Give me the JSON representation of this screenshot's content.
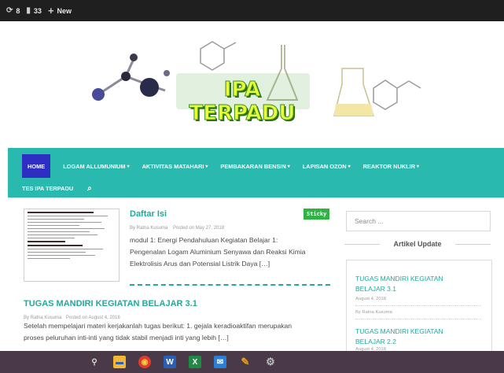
{
  "adminbar": {
    "items": [
      {
        "icon": "refresh-icon",
        "glyph": "⟳",
        "label": "8"
      },
      {
        "icon": "comment-icon",
        "glyph": "▮",
        "label": "33"
      },
      {
        "icon": "plus-icon",
        "glyph": "+",
        "label": "New"
      }
    ]
  },
  "site": {
    "title": "IPA TERPADU"
  },
  "nav": {
    "row1": [
      {
        "label": "HOME",
        "caret": ""
      },
      {
        "label": "LOGAM ALLUMUNIUM",
        "caret": "▾"
      },
      {
        "label": "AKTIVITAS MATAHARI",
        "caret": "▾"
      },
      {
        "label": "PEMBAKARAN BENSIN",
        "caret": "▾"
      },
      {
        "label": "LAPISAN OZON",
        "caret": "▾"
      },
      {
        "label": "REAKTOR NUKLIR",
        "caret": "▾"
      }
    ],
    "row2": [
      {
        "label": "TES IPA TERPADU"
      }
    ],
    "search_glyph": "⌕"
  },
  "posts": [
    {
      "title": "Daftar Isi",
      "badge": "Sticky",
      "author": "By Ratna Kusuma",
      "date": "Posted on May 27, 2018",
      "excerpt_lines": [
        "modul 1: Energi Pendahuluan Kegiatan Belajar 1:",
        "Pengenalan Logam Aluminium Senyawa dan Reaksi Kimia",
        "Elektrolisis Arus dan Potensial Listrik Daya […]"
      ]
    },
    {
      "title": "TUGAS MANDIRI KEGIATAN BELAJAR 3.1",
      "author": "By Ratna Kusuma",
      "date": "Posted on August 4, 2018",
      "excerpt_lines": [
        "Setelah mempelajari materi kerjakanlah tugas berikut: 1. gejala keradioaktifan merupakan",
        "proses peluruhan inti-inti yang tidak stabil menjadi inti yang lebih […]"
      ]
    }
  ],
  "sidebar": {
    "search_placeholder": "Search ...",
    "widget_title": "Artikel Update",
    "items": [
      {
        "title_lines": [
          "TUGAS MANDIRI KEGIATAN",
          "BELAJAR 3.1"
        ],
        "date": "August 4, 2018",
        "author": "By Ratna Kusuma"
      },
      {
        "title_lines": [
          "TUGAS MANDIRI KEGIATAN",
          "BELAJAR 2.2"
        ],
        "date": "August 4, 2018"
      }
    ]
  },
  "taskbar": {
    "apps": [
      {
        "icon": "search-icon",
        "glyph": "⚲",
        "color": "#4a3946"
      },
      {
        "icon": "file-explorer-icon",
        "glyph": "▬",
        "color": "#f2b632"
      },
      {
        "icon": "chrome-icon",
        "glyph": "◉",
        "color": "#e23b2e"
      },
      {
        "icon": "word-icon",
        "glyph": "W",
        "color": "#2b5fb4"
      },
      {
        "icon": "excel-icon",
        "glyph": "X",
        "color": "#1f8a46"
      },
      {
        "icon": "mail-icon",
        "glyph": "✉",
        "color": "#2b7fd4"
      },
      {
        "icon": "paint-icon",
        "glyph": "✎",
        "color": "#e0a020"
      },
      {
        "icon": "tool-icon",
        "glyph": "⚙",
        "color": "#8a8a8a"
      }
    ]
  }
}
